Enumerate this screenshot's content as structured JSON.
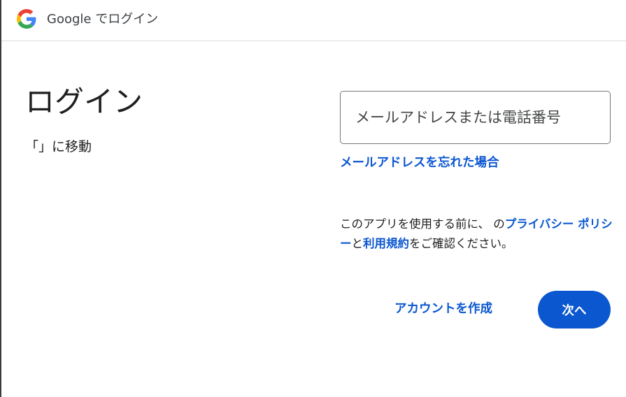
{
  "header": {
    "title": "Google でログイン",
    "logo_icon": "google-g-icon"
  },
  "main": {
    "title": "ログイン",
    "subtitle": "「」に移動"
  },
  "form": {
    "email_placeholder": "メールアドレスまたは電話番号",
    "forgot_email_link": "メールアドレスを忘れた場合"
  },
  "privacy": {
    "text_before": "このアプリを使用する前に、 の",
    "privacy_policy_link": "プライバシー ポリシー",
    "text_middle": "と",
    "terms_link": "利用規約",
    "text_after": "をご確認ください。"
  },
  "actions": {
    "create_account_label": "アカウントを作成",
    "next_label": "次へ"
  },
  "colors": {
    "accent": "#0b57d0",
    "google_blue": "#4285f4",
    "google_red": "#ea4335",
    "google_yellow": "#fbbc05",
    "google_green": "#34a853"
  }
}
